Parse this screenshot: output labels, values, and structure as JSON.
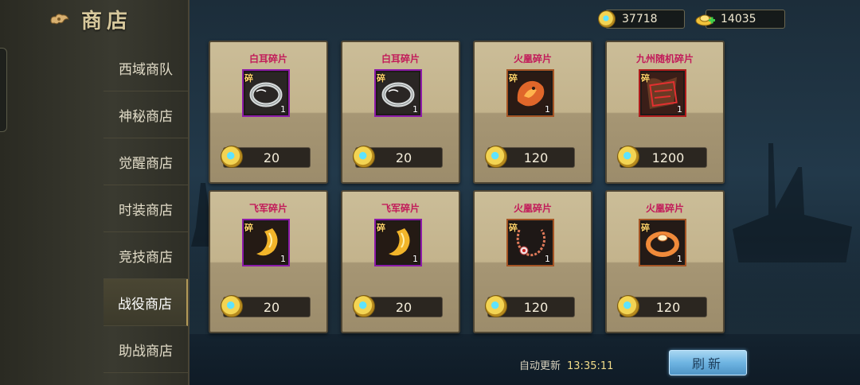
{
  "header": {
    "title": "商店"
  },
  "currencies": {
    "diamonds": {
      "value": "37718",
      "icon": "diamond-coin-icon"
    },
    "gold": {
      "value": "14035",
      "icon": "gold-ingot-icon"
    }
  },
  "sidebar": {
    "items": [
      {
        "label": "西域商队"
      },
      {
        "label": "神秘商店"
      },
      {
        "label": "觉醒商店"
      },
      {
        "label": "时装商店"
      },
      {
        "label": "竞技商店"
      },
      {
        "label": "战役商店",
        "active": true
      },
      {
        "label": "助战商店"
      }
    ]
  },
  "shop": {
    "fragment_badge": "碎",
    "items": [
      {
        "name": "白耳碎片",
        "qty": "1",
        "price": "20",
        "icon": "silver-ring-icon"
      },
      {
        "name": "白耳碎片",
        "qty": "1",
        "price": "20",
        "icon": "silver-ring-icon"
      },
      {
        "name": "火凰碎片",
        "qty": "1",
        "price": "120",
        "icon": "fire-phoenix-icon"
      },
      {
        "name": "九州随机碎片",
        "qty": "1",
        "price": "1200",
        "icon": "seal-stamp-icon"
      },
      {
        "name": "飞军碎片",
        "qty": "1",
        "price": "20",
        "icon": "golden-hook-icon"
      },
      {
        "name": "飞军碎片",
        "qty": "1",
        "price": "20",
        "icon": "golden-hook-icon"
      },
      {
        "name": "火凰碎片",
        "qty": "1",
        "price": "120",
        "icon": "bead-necklace-icon"
      },
      {
        "name": "火凰碎片",
        "qty": "1",
        "price": "120",
        "icon": "orange-ring-icon"
      }
    ]
  },
  "footer": {
    "auto_refresh_label": "自动更新",
    "auto_refresh_time": "13:35:11",
    "refresh_button": "刷新"
  },
  "colors": {
    "item_name": "#c21b5a",
    "refresh_button": "#6eb4e2",
    "sidebar_active": "#4a4633"
  }
}
